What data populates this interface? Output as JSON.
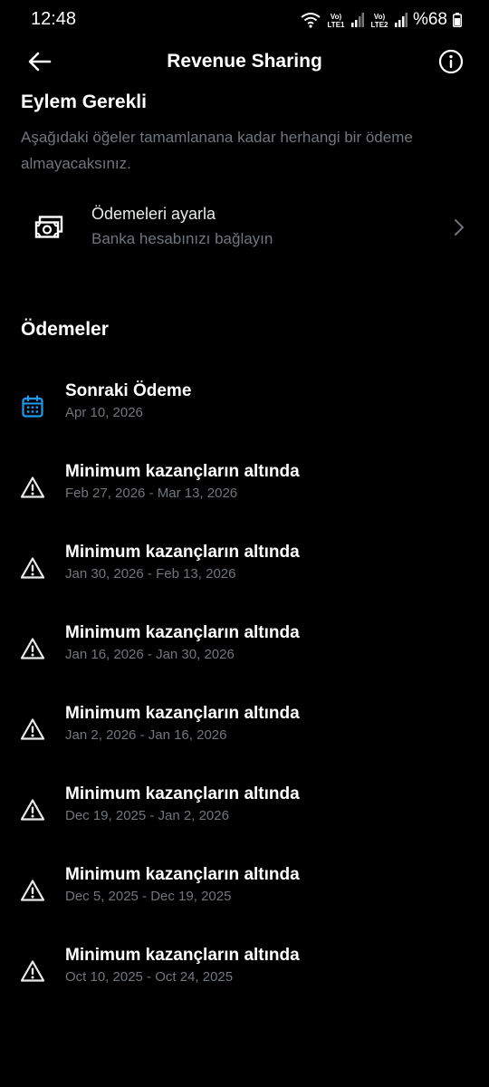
{
  "status_bar": {
    "time": "12:48",
    "sim1": "Vo) LTE1",
    "sim2": "Vo) LTE2",
    "battery": "%68"
  },
  "header": {
    "title": "Revenue Sharing"
  },
  "action_required": {
    "title": "Eylem Gerekli",
    "description": "Aşağıdaki öğeler tamamlanana kadar herhangi bir ödeme almayacaksınız.",
    "setup": {
      "title": "Ödemeleri ayarla",
      "subtitle": "Banka hesabınızı bağlayın"
    }
  },
  "payments": {
    "title": "Ödemeler",
    "next": {
      "title": "Sonraki Ödeme",
      "date": "Apr 10, 2026"
    },
    "items": [
      {
        "title": "Minimum kazançların altında",
        "range": "Feb 27, 2026 - Mar 13, 2026"
      },
      {
        "title": "Minimum kazançların altında",
        "range": "Jan 30, 2026 - Feb 13, 2026"
      },
      {
        "title": "Minimum kazançların altında",
        "range": "Jan 16, 2026 - Jan 30, 2026"
      },
      {
        "title": "Minimum kazançların altında",
        "range": "Jan 2, 2026 - Jan 16, 2026"
      },
      {
        "title": "Minimum kazançların altında",
        "range": "Dec 19, 2025 - Jan 2, 2026"
      },
      {
        "title": "Minimum kazançların altında",
        "range": "Dec 5, 2025 - Dec 19, 2025"
      },
      {
        "title": "Minimum kazançların altında",
        "range": "Oct 10, 2025 - Oct 24, 2025"
      }
    ]
  },
  "colors": {
    "background": "#000000",
    "text_primary": "#e7e9ea",
    "text_secondary": "#71767b",
    "calendar_accent": "#1d9bf0"
  }
}
